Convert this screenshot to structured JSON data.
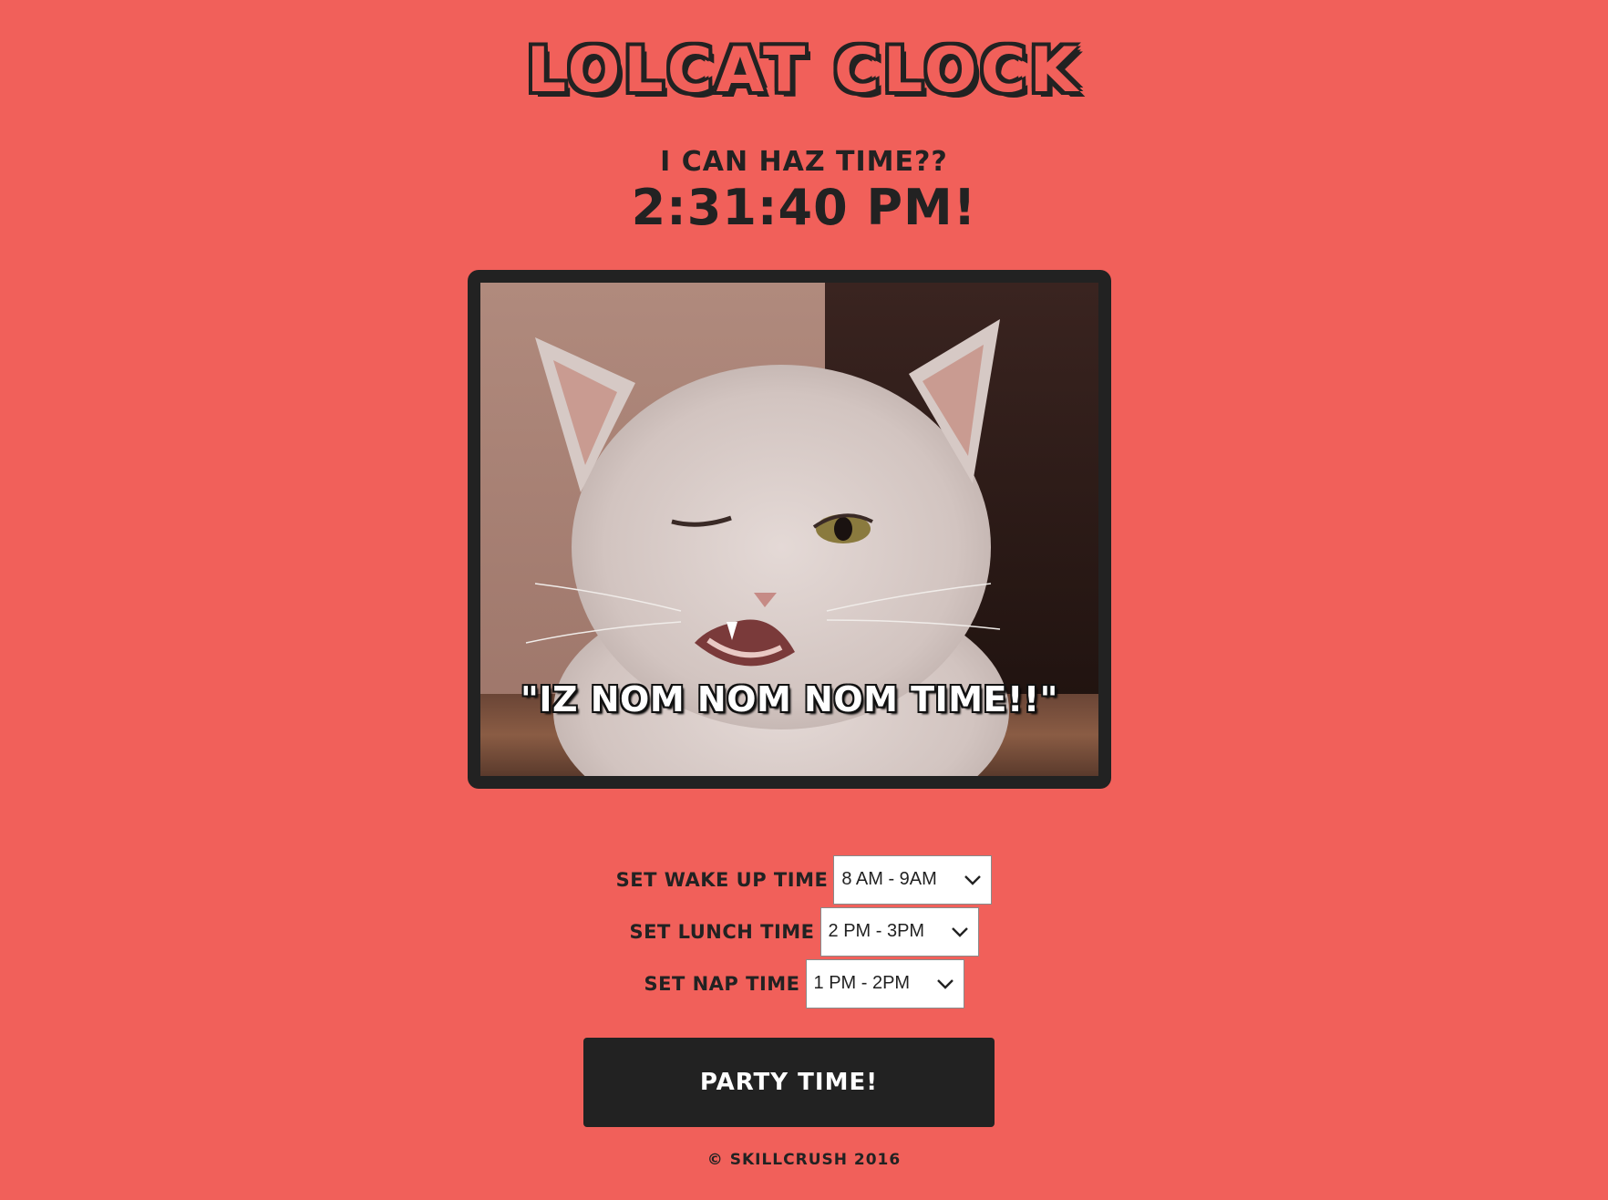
{
  "header": {
    "title": "Lolcat Clock",
    "subtitle": "I can haz time??",
    "time": "2:31:40 PM!"
  },
  "image": {
    "caption": "\"IZ NOM NOM NOM TIME!!\""
  },
  "controls": {
    "wake": {
      "label": "Set Wake Up Time",
      "value": "8 AM - 9AM"
    },
    "lunch": {
      "label": "Set Lunch Time",
      "value": "2 PM - 3PM"
    },
    "nap": {
      "label": "Set Nap Time",
      "value": "1 PM - 2PM"
    }
  },
  "party_button": {
    "label": "Party Time!"
  },
  "footer": {
    "text": "© Skillcrush 2016"
  },
  "colors": {
    "background": "#f1605a",
    "dark": "#222222"
  },
  "icons": {
    "select_indicator": "chevron-down-icon"
  }
}
